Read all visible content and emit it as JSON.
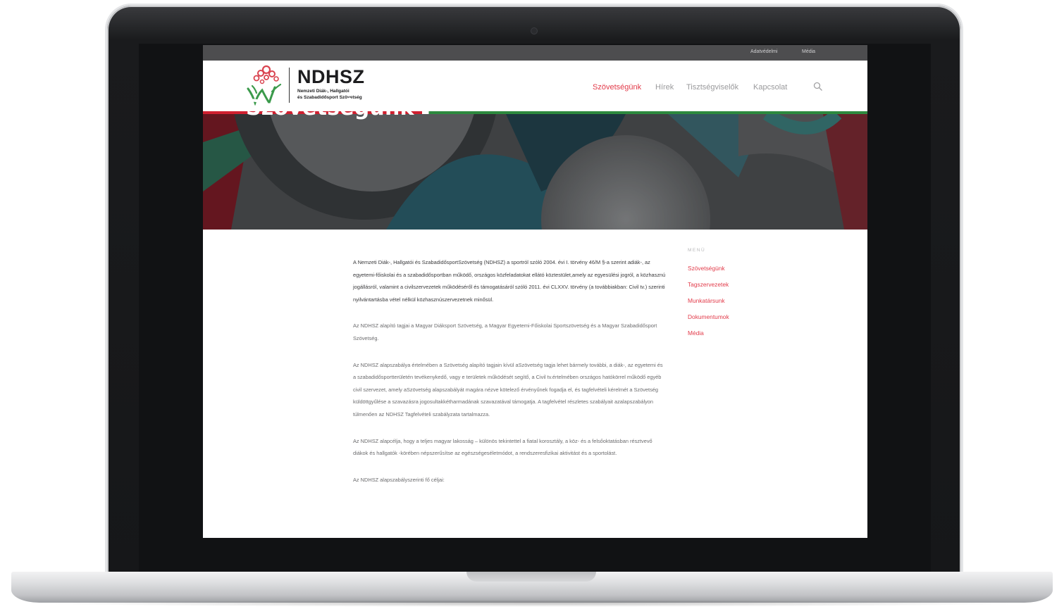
{
  "topbar": {
    "links": [
      "Adatvédelmi",
      "Média"
    ]
  },
  "logo": {
    "title": "NDHSZ",
    "subtitle_line1": "Nemzeti Diák-, Hallgatói",
    "subtitle_line2": "és Szabadidősport Szövetség"
  },
  "nav": {
    "items": [
      "Szövetségünk",
      "Hírek",
      "Tisztségviselők",
      "Kapcsolat"
    ],
    "active_color": "#e23b4a"
  },
  "hero": {
    "title": "Szövetségünk"
  },
  "sidebar": {
    "heading": "MENÜ",
    "items": [
      "Szövetségünk",
      "Tagszervezetek",
      "Munkatársunk",
      "Dokumentumok",
      "Média"
    ]
  },
  "content": {
    "paragraphs": [
      "A Nemzeti Diák-, Hallgatói és SzabadidősportSzövetség (NDHSZ) a sportról szóló 2004. évi I. törvény 46/M §-a szerint adiák-, az egyetemi-főiskolai és a szabadidősportban működő, országos közfeladatokat ellátó köztestület,amely az egyesülési jogról, a közhasznú jogállásról, valamint a civilszervezetek működéséről és támogatásáról szóló 2011. évi CLXXV. törvény (a továbbiakban: Civil tv.) szerinti nyilvántartásba vétel nélkül közhasznúszervezetnek minősül.",
      "Az NDHSZ alapító tagjai a Magyar Diáksport Szövetség, a Magyar Egyetemi-Főiskolai Sportszövetség és a Magyar Szabadidősport Szövetség.",
      "Az NDHSZ alapszabálya értelmében a Szövetség alapító tagjain kívül aSzövetség tagja lehet bármely további, a diák-, az egyetemi és a szabadidősportterületén tevékenykedő, vagy e területek működését segítő, a Civil tv.értelmében országos hatókörrel működő egyéb civil szervezet, amely aSzövetség alapszabályát magára nézve kötelező érvényűnek fogadja el, és tagfelvételi kérelmét a Szövetség küldöttgyűlése a szavazásra jogosultakkétharmadának szavazatával támogatja. A tagfelvétel részletes szabályait azalapszabályon túlmenően az NDHSZ Tagfelvételi szabályzata tartalmazza.",
      "Az NDHSZ alapcélja, hogy a teljes magyar lakosság – különös tekintettel a fiatal korosztály, a köz- és a felsőoktatásban résztvevő diákok és hallgatók -körében népszerűsítse az egészségesélet­módot, a rendszeresfizikai aktivitást és a sportolást.",
      "Az NDHSZ alapszabályszerinti fő céljai:"
    ]
  }
}
